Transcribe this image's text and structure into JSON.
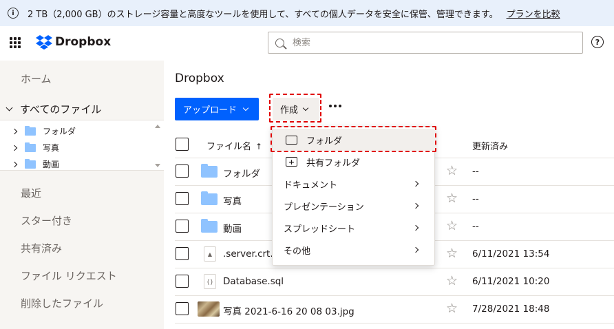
{
  "banner": {
    "info_icon": "info-icon",
    "text": "2 TB（2,000 GB）のストレージ容量と高度なツールを使用して、すべての個人データを安全に保管、管理できます。",
    "link": "プランを比較"
  },
  "topbar": {
    "logo_text": "Dropbox",
    "search_placeholder": "検索",
    "help_glyph": "?"
  },
  "sidebar": {
    "home": "ホーム",
    "all_files": "すべてのファイル",
    "tree": [
      {
        "label": "フォルダ"
      },
      {
        "label": "写真"
      },
      {
        "label": "動画"
      }
    ],
    "items": [
      {
        "label": "最近"
      },
      {
        "label": "スター付き"
      },
      {
        "label": "共有済み"
      },
      {
        "label": "ファイル リクエスト"
      },
      {
        "label": "削除したファイル"
      }
    ]
  },
  "main": {
    "title": "Dropbox",
    "upload_label": "アップロード",
    "create_label": "作成",
    "columns": {
      "name": "ファイル名",
      "modified": "更新済み"
    },
    "rows": [
      {
        "name": "フォルダ",
        "type": "folder",
        "modified": "--"
      },
      {
        "name": "写真",
        "type": "folder",
        "modified": "--"
      },
      {
        "name": "動画",
        "type": "folder",
        "modified": "--"
      },
      {
        "name": ".server.crt.s",
        "type": "file",
        "modified": "6/11/2021 13:54"
      },
      {
        "name": "Database.sql",
        "type": "sql",
        "modified": "6/11/2021 10:20"
      },
      {
        "name": "写真 2021-6-16 20 08 03.jpg",
        "type": "image",
        "modified": "7/28/2021 18:48"
      }
    ]
  },
  "menu": {
    "items": [
      {
        "label": "フォルダ",
        "icon": "folder-icon",
        "selected": true
      },
      {
        "label": "共有フォルダ",
        "icon": "shared-folder-icon"
      },
      {
        "label": "ドキュメント",
        "submenu": true
      },
      {
        "label": "プレゼンテーション",
        "submenu": true
      },
      {
        "label": "スプレッドシート",
        "submenu": true
      },
      {
        "label": "その他",
        "submenu": true
      }
    ]
  },
  "colors": {
    "accent": "#0061fe",
    "highlight": "#e00000",
    "folder": "#8fc3ff",
    "sidebar": "#f7f5f2",
    "banner": "#e8f0fb"
  }
}
